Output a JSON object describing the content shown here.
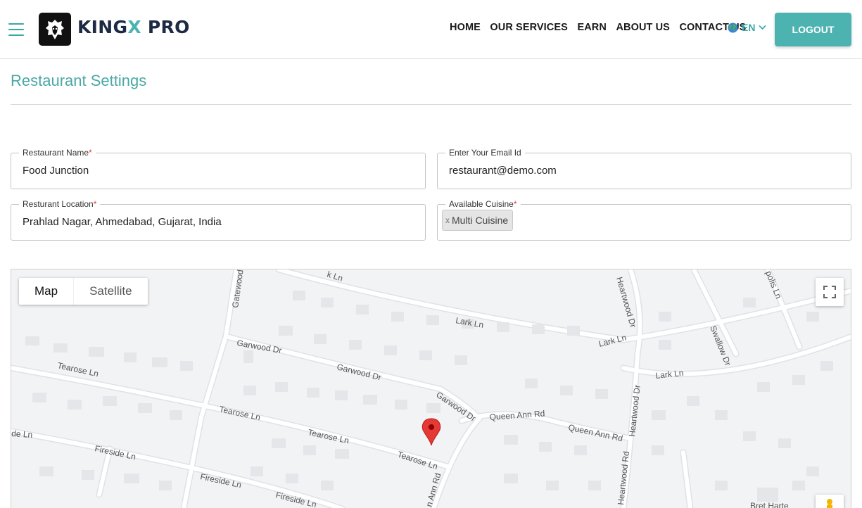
{
  "header": {
    "brand_prefix": "KING",
    "brand_x": "X",
    "brand_suffix": " PRO",
    "nav": [
      "HOME",
      "OUR SERVICES",
      "EARN",
      "ABOUT US",
      "CONTACT US"
    ],
    "language": "EN",
    "logout_label": "LOGOUT",
    "accent_color": "#4db3b0"
  },
  "page": {
    "title": "Restaurant Settings"
  },
  "form": {
    "restaurant_name": {
      "label": "Restaurant Name",
      "required": "*",
      "value": "Food Junction"
    },
    "email": {
      "label": "Enter Your Email Id",
      "value": "restaurant@demo.com"
    },
    "location": {
      "label": "Resturant Location",
      "required": "*",
      "value": "Prahlad Nagar, Ahmedabad, Gujarat, India"
    },
    "cuisine": {
      "label": "Available Cuisine",
      "required": "*",
      "chip_remove": "x",
      "chips": [
        "Multi Cuisine"
      ]
    }
  },
  "map": {
    "tab_map": "Map",
    "tab_satellite": "Satellite",
    "streets": {
      "ln_top": "k Ln",
      "gatewood": "Gatewood",
      "lark_ln_1": "Lark Ln",
      "lark_ln_2": "Lark Ln",
      "lark_ln_3": "Lark Ln",
      "heartwood_dr_1": "Heartwood Dr",
      "heartwood_dr_2": "Heartwood Dr",
      "heartwood_rd": "Heartwood Rd",
      "swallow_dr": "Swallow Dr",
      "polis_ln": "polis Ln",
      "garwood_dr_1": "Garwood Dr",
      "garwood_dr_2": "Garwood Dr",
      "garwood_dr_3": "Garwood Dr",
      "tearose_ln_1": "Tearose Ln",
      "tearose_ln_2": "Tearose Ln",
      "tearose_ln_3": "Tearose Ln",
      "tearose_ln_4": "Tearose Ln",
      "queen_ann_rd_1": "Queen Ann Rd",
      "queen_ann_rd_2": "Queen Ann Rd",
      "queen_ann_rd_3": "n Ann Rd",
      "fireside_ln_1": "Fireside Ln",
      "fireside_ln_2": "Fireside Ln",
      "fireside_ln_3": "Fireside Ln",
      "de_ln": "de Ln",
      "bret_harte": "Bret Harte"
    },
    "marker_color": "#e53935"
  }
}
